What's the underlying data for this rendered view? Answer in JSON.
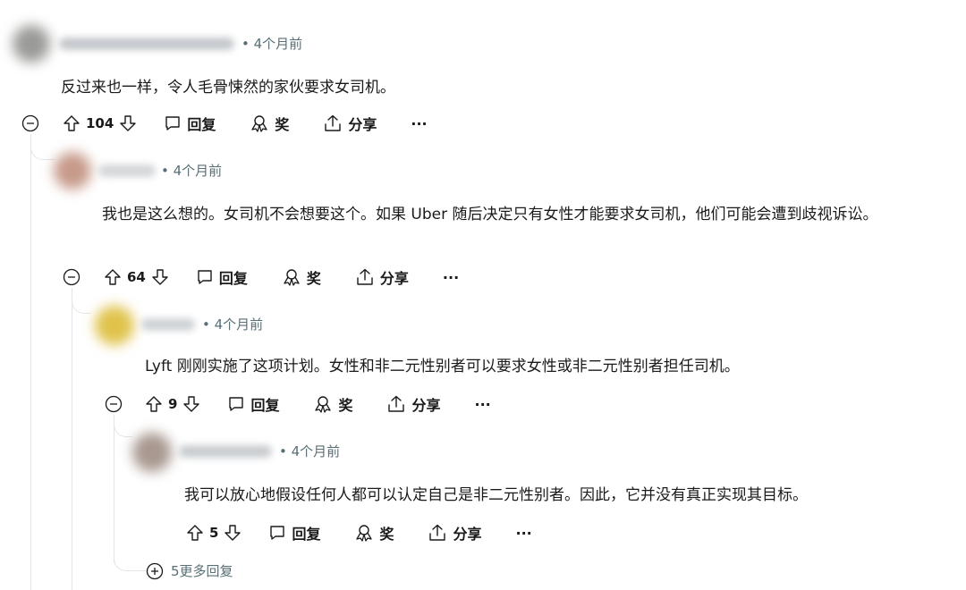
{
  "comments": [
    {
      "time": "4个月前",
      "text": "反过来也一样，令人毛骨悚然的家伙要求女司机。",
      "votes": "104",
      "avatar_color": "#9a9a98",
      "name_color": "#c4c8cc"
    },
    {
      "time": "4个月前",
      "text": "我也是这么想的。女司机不会想要这个。如果 Uber 随后决定只有女性才能要求女司机，他们可能会遭到歧视诉讼。",
      "votes": "64",
      "avatar_color": "#c79a8a",
      "name_color": "#d4d6d8"
    },
    {
      "time": "4个月前",
      "text": "Lyft 刚刚实施了这项计划。女性和非二元性别者可以要求女性或非二元性别者担任司机。",
      "votes": "9",
      "avatar_color": "#e0c24a",
      "name_color": "#cfd3d6"
    },
    {
      "time": "4个月前",
      "text": "我可以放心地假设任何人都可以认定自己是非二元性别者。因此，它并没有真正实现其目标。",
      "votes": "5",
      "avatar_color": "#a89890",
      "name_color": "#c9cdd0"
    }
  ],
  "actions": {
    "reply": "回复",
    "award": "奖",
    "share": "分享",
    "more": "···"
  },
  "bullet": "•",
  "more_replies": "5更多回复"
}
